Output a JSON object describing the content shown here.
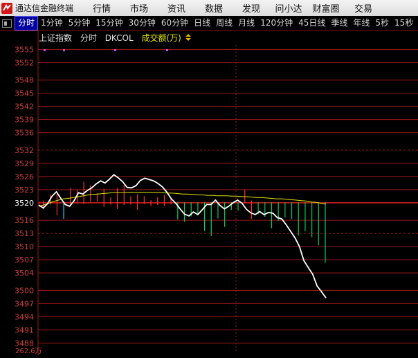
{
  "window": {
    "title": "通达信金融终端",
    "menu": [
      "行情",
      "市场",
      "资讯",
      "数据",
      "发现",
      "问小达",
      "财富圈",
      "交易"
    ]
  },
  "periods": {
    "active_index": 0,
    "items": [
      "分时",
      "1分钟",
      "5分钟",
      "15分钟",
      "30分钟",
      "60分钟",
      "日线",
      "周线",
      "月线",
      "120分钟",
      "45日线",
      "季线",
      "年线",
      "5秒",
      "15秒"
    ]
  },
  "chart_header": {
    "index_name": "上证指数",
    "mode": "分时",
    "indicator": "DKCOL",
    "volume_label": "成交额(万)"
  },
  "colors": {
    "price_line": "#ffffff",
    "avg_line": "#e6e600",
    "up_bar": "#ff3030",
    "down_bar": "#30c8ff",
    "fall_bar": "#00d060",
    "grid": "#a01818",
    "axis_text": "#d04040"
  },
  "chart_data": {
    "type": "line",
    "y_ticks": [
      "3555",
      "3552",
      "3548",
      "3545",
      "3542",
      "3539",
      "3536",
      "3532",
      "3529",
      "3526",
      "3523",
      "3520",
      "3516",
      "3513",
      "3510",
      "3507",
      "3504",
      "3500",
      "3497",
      "3494",
      "3491",
      "3488"
    ],
    "bottom_label": "262.6万",
    "reference": 3520,
    "ylim": [
      3486,
      3556
    ],
    "series": [
      {
        "values": [
          3519.5,
          3518.8,
          3519.8,
          3521.5,
          3522.5,
          3521.0,
          3519.6,
          3519.2,
          3520.5,
          3522.3,
          3522.0,
          3522.8,
          3523.4,
          3524.3,
          3525.0,
          3524.5,
          3525.4,
          3526.4,
          3525.7,
          3524.8,
          3523.5,
          3523.4,
          3523.9,
          3525.1,
          3525.6,
          3525.3,
          3525.0,
          3524.4,
          3523.6,
          3522.4,
          3520.9,
          3519.9,
          3518.6,
          3517.4,
          3517.0,
          3517.9,
          3517.3,
          3518.4,
          3519.6,
          3519.6,
          3520.6,
          3519.4,
          3518.6,
          3519.2,
          3520.0,
          3520.6,
          3519.9,
          3518.5,
          3517.7,
          3517.3,
          3518.0,
          3517.3,
          3517.8,
          3517.6,
          3516.6,
          3516.3,
          3515.0,
          3513.5,
          3512.0,
          3510.0,
          3506.8,
          3505.2,
          3503.7,
          3501.0,
          3499.7,
          3498.3
        ]
      },
      {
        "values": [
          3519.2,
          3519.5,
          3519.9,
          3520.3,
          3520.6,
          3520.9,
          3521.0,
          3521.2,
          3521.4,
          3521.6,
          3521.8,
          3521.9,
          3522.0,
          3522.1,
          3522.2,
          3522.3,
          3522.3,
          3522.4,
          3522.4,
          3522.4,
          3522.4,
          3522.4,
          3522.4,
          3522.4,
          3522.3,
          3522.3,
          3522.2,
          3522.2,
          3522.1,
          3522.0,
          3522.0,
          3521.9,
          3521.8,
          3521.8,
          3521.7,
          3521.7,
          3521.6,
          3521.6,
          3521.6,
          3521.5,
          3521.5,
          3521.4,
          3521.4,
          3521.3,
          3521.2,
          3521.2,
          3521.1,
          3521.0,
          3520.9,
          3520.9,
          3520.8,
          3520.7,
          3520.6,
          3520.5,
          3520.4,
          3520.2,
          3520.1,
          3519.9,
          3519.7
        ]
      }
    ],
    "volume_bars": [
      [
        3520.5,
        3518.5
      ],
      [
        3521.8,
        3519.6
      ],
      [
        3522.0,
        3517.2
      ],
      [
        3519.8,
        3516.3
      ],
      [
        3523.4,
        3519.6
      ],
      [
        3522.9,
        3519.8
      ],
      [
        3524.8,
        3519.7
      ],
      [
        3524.0,
        3520.2
      ],
      [
        3522.2,
        3520.3
      ],
      [
        3523.2,
        3519.1
      ],
      [
        3521.2,
        3519.6
      ],
      [
        3523.4,
        3518.6
      ],
      [
        3524.1,
        3519.5
      ],
      [
        3521.5,
        3519.6
      ],
      [
        3522.0,
        3518.4
      ],
      [
        3521.5,
        3519.7
      ],
      [
        3520.6,
        3519.3
      ],
      [
        3521.3,
        3519.5
      ],
      [
        3521.8,
        3519.3
      ],
      [
        3521.0,
        3519.6
      ],
      [
        3520.2,
        3516.2
      ],
      [
        3520.1,
        3515.7
      ],
      [
        3520.1,
        3516.9
      ],
      [
        3520.1,
        3517.3
      ],
      [
        3520.1,
        3513.6
      ],
      [
        3520.1,
        3512.4
      ],
      [
        3520.1,
        3516.4
      ],
      [
        3520.1,
        3514.5
      ],
      [
        3520.1,
        3518.4
      ],
      [
        3520.1,
        3518.2
      ],
      [
        3523.0,
        3519.9
      ],
      [
        3520.5,
        3516.3
      ],
      [
        3520.1,
        3517.4
      ],
      [
        3520.1,
        3516.8
      ],
      [
        3520.1,
        3514.2
      ],
      [
        3520.1,
        3515.9
      ],
      [
        3520.1,
        3516.6
      ],
      [
        3520.1,
        3516.3
      ],
      [
        3520.1,
        3512.5
      ],
      [
        3520.1,
        3513.5
      ],
      [
        3520.1,
        3512.1
      ],
      [
        3520.1,
        3510.3
      ],
      [
        3520.1,
        3506.3
      ]
    ]
  }
}
